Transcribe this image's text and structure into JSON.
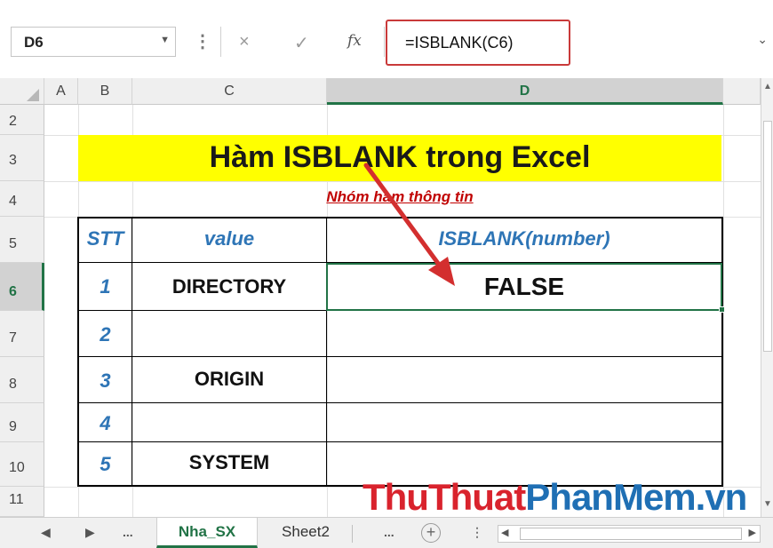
{
  "formula_bar": {
    "name_box": "D6",
    "cancel_icon": "×",
    "enter_icon": "✓",
    "fx_label": "fx",
    "formula": "=ISBLANK(C6)"
  },
  "columns": [
    "A",
    "B",
    "C",
    "D"
  ],
  "rows": [
    "2",
    "3",
    "4",
    "5",
    "6",
    "7",
    "8",
    "9",
    "10",
    "11"
  ],
  "sheet": {
    "title": "Hàm ISBLANK trong Excel",
    "subtitle": "Nhóm hàm thông tin",
    "headers": {
      "stt": "STT",
      "value": "value",
      "result": "ISBLANK(number)"
    },
    "table_rows": [
      {
        "stt": "1",
        "value": "DIRECTORY",
        "result": "FALSE"
      },
      {
        "stt": "2",
        "value": "",
        "result": ""
      },
      {
        "stt": "3",
        "value": "ORIGIN",
        "result": ""
      },
      {
        "stt": "4",
        "value": "",
        "result": ""
      },
      {
        "stt": "5",
        "value": "SYSTEM",
        "result": ""
      }
    ]
  },
  "watermark": {
    "part1": "ThuThuat",
    "part2": "PhanMem.vn"
  },
  "tabs": {
    "prev": "◀",
    "next": "▶",
    "more_left": "...",
    "items": [
      "Nha_SX",
      "Sheet2"
    ],
    "more_right": "...",
    "add": "+"
  },
  "colors": {
    "accent": "#217346",
    "header_blue": "#2e75b6",
    "title_fill": "#ffff00",
    "subtitle_red": "#c00000",
    "arrow_red": "#d32f2f"
  }
}
